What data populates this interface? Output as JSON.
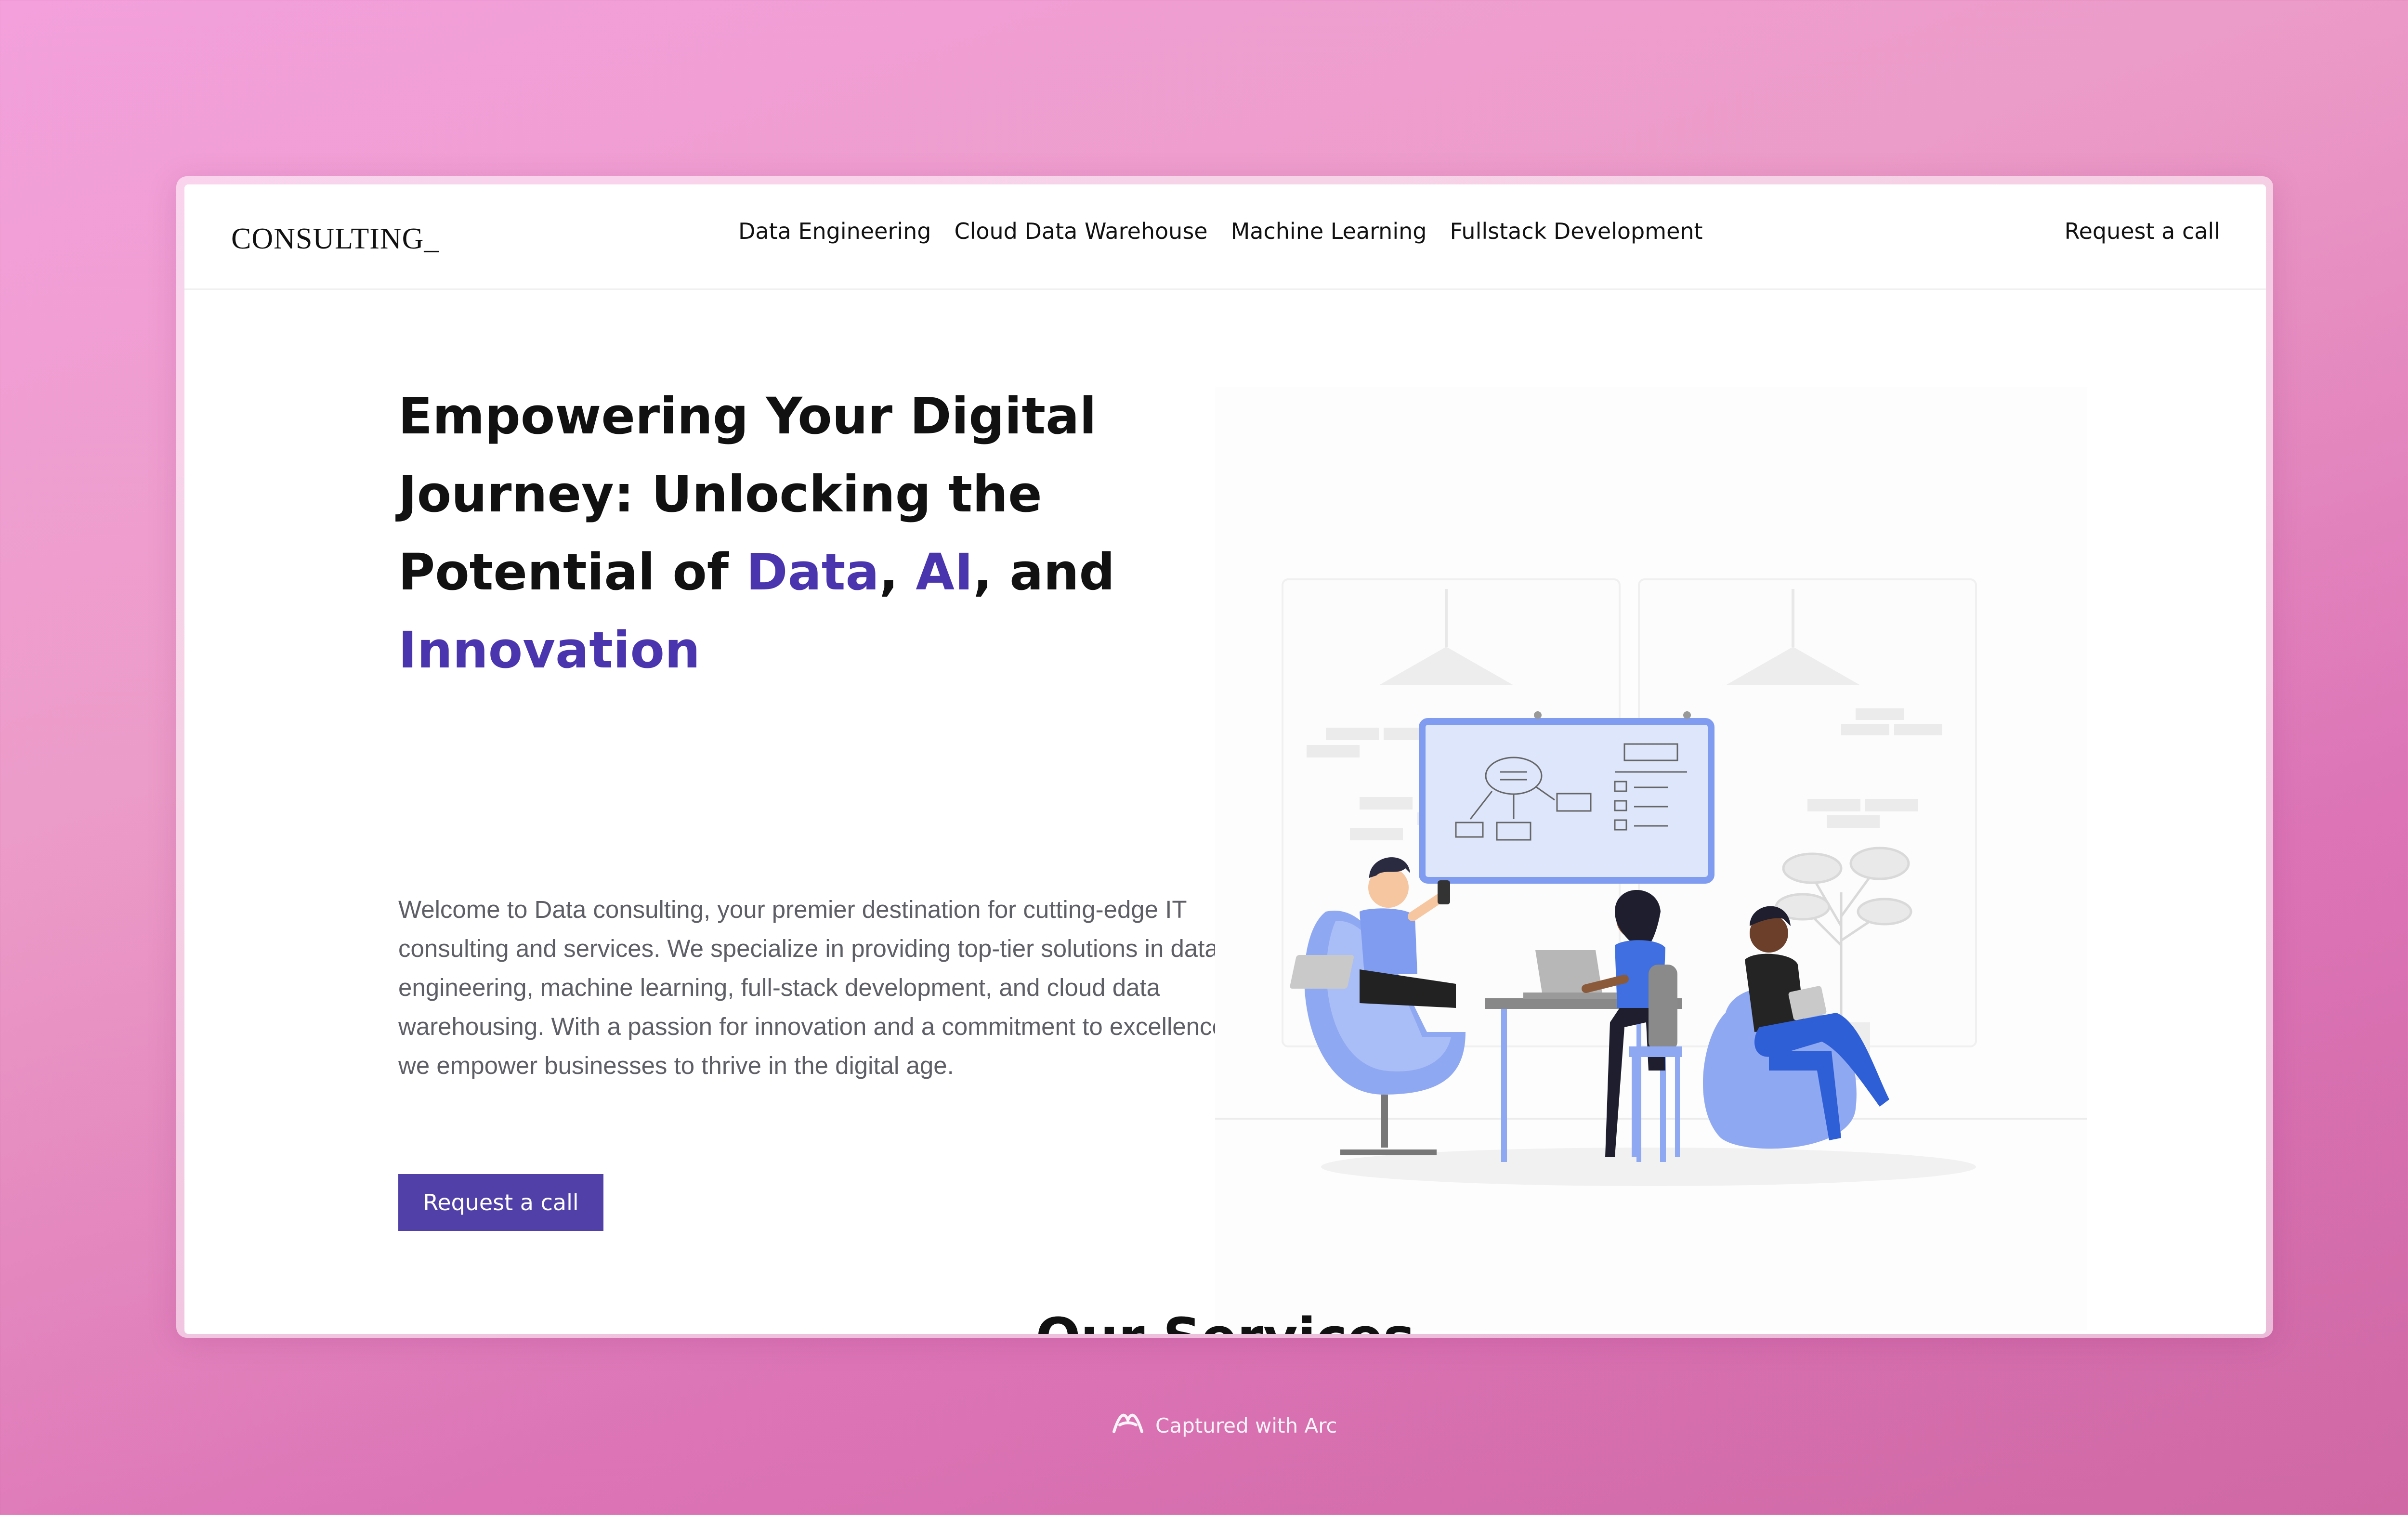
{
  "nav": {
    "logo": "CONSULTING_",
    "links": [
      "Data Engineering",
      "Cloud Data Warehouse",
      "Machine Learning",
      "Fullstack Development"
    ],
    "cta": "Request a call"
  },
  "hero": {
    "title_part1": "Empowering Your Digital Journey: Unlocking the Potential of ",
    "title_data": "Data",
    "title_sep1": ", ",
    "title_ai": "AI",
    "title_sep2": ", and ",
    "title_innovation": "Innovation",
    "body": "Welcome to Data consulting, your premier destination for cutting-edge IT consulting and services. We specialize in providing top-tier solutions in data engineering, machine learning, full-stack development, and cloud data warehousing. With a passion for innovation and a commitment to excellence, we empower businesses to thrive in the digital age.",
    "cta": "Request a call"
  },
  "services": {
    "heading": "Our Services"
  },
  "footer": {
    "capture_text": "Captured with Arc"
  },
  "colors": {
    "accent": "#4a35ae",
    "button": "#5040a8",
    "illustration_blue": "#7f9cf0"
  }
}
